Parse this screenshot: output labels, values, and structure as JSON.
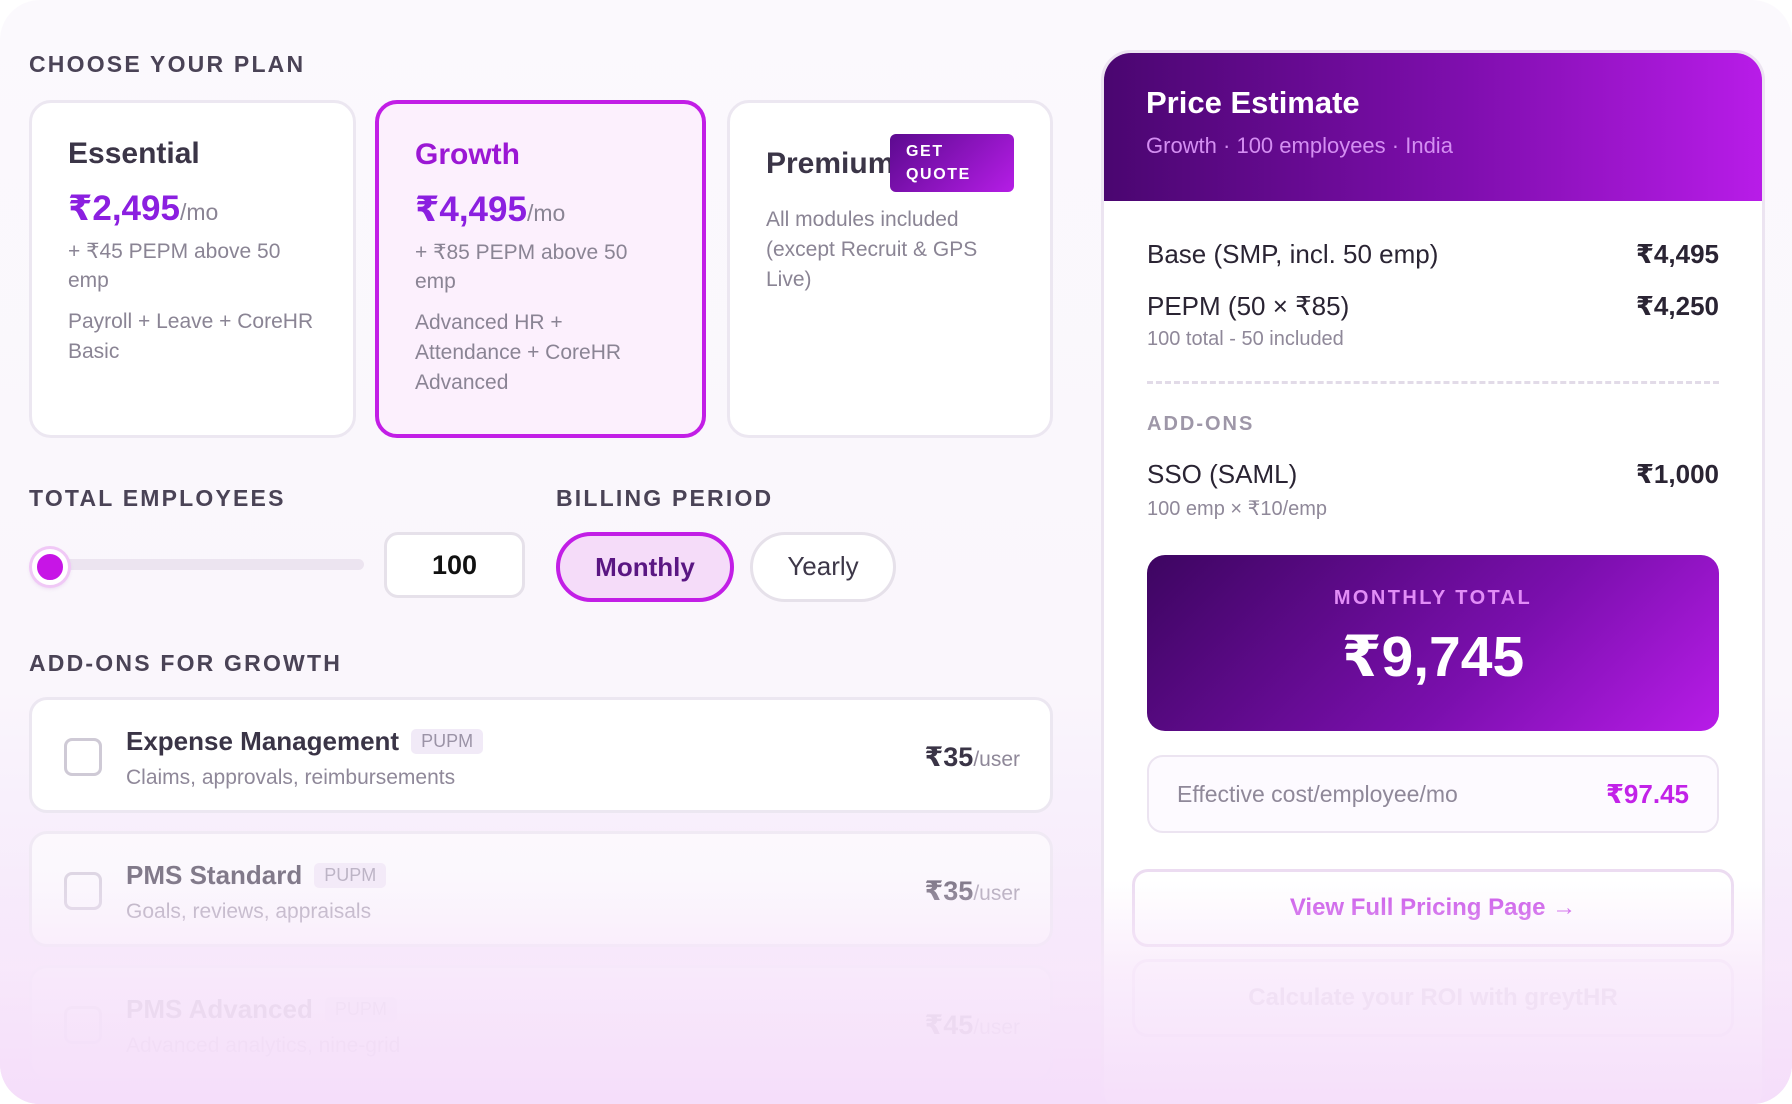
{
  "plans_section": {
    "label": "CHOOSE YOUR PLAN"
  },
  "plans": [
    {
      "name": "Essential",
      "price": "₹2,495",
      "period": "/mo",
      "pepm": "+ ₹45 PEPM above 50 emp",
      "modules": "Payroll + Leave + CoreHR Basic",
      "selected": false
    },
    {
      "name": "Growth",
      "price": "₹4,495",
      "period": "/mo",
      "pepm": "+ ₹85 PEPM above 50 emp",
      "modules": "Advanced HR + Attendance + CoreHR Advanced",
      "selected": true
    },
    {
      "name": "Premium",
      "badge": "GET QUOTE",
      "description": "All modules included (except Recruit & GPS Live)",
      "selected": false
    }
  ],
  "employees": {
    "label": "TOTAL EMPLOYEES",
    "value": "100",
    "slider_fraction": 0.02
  },
  "billing": {
    "label": "BILLING PERIOD",
    "options": [
      "Monthly",
      "Yearly"
    ],
    "selected": "Monthly"
  },
  "addons_section": {
    "label": "ADD-ONS FOR GROWTH"
  },
  "addons": [
    {
      "title": "Expense Management",
      "tag": "PUPM",
      "subtitle": "Claims, approvals, reimbursements",
      "price": "₹35",
      "unit": "/user",
      "checked": false
    },
    {
      "title": "PMS Standard",
      "tag": "PUPM",
      "subtitle": "Goals, reviews, appraisals",
      "price": "₹35",
      "unit": "/user",
      "checked": false
    },
    {
      "title": "PMS Advanced",
      "tag": "PUPM",
      "subtitle": "Advanced analytics, nine-grid",
      "price": "₹45",
      "unit": "/user",
      "checked": false
    }
  ],
  "estimate": {
    "title": "Price Estimate",
    "subtitle": "Growth · 100 employees · India",
    "base_label": "Base (SMP, incl. 50 emp)",
    "base_value": "₹4,495",
    "pepm_label": "PEPM (50 × ₹85)",
    "pepm_value": "₹4,250",
    "pepm_note": "100 total - 50 included",
    "addons_label": "ADD-ONS",
    "addon_label": "SSO (SAML)",
    "addon_value": "₹1,000",
    "addon_note": "100 emp × ₹10/emp",
    "total_label": "MONTHLY TOTAL",
    "total_value": "₹9,745",
    "effective_label": "Effective cost/employee/mo",
    "effective_value": "₹97.45",
    "pricing_link": "View Full Pricing Page →",
    "roi_link": "Calculate your ROI with greytHR"
  },
  "colors": {
    "accent": "#c21ee6",
    "brand_dark": "#4a0670",
    "brand_light": "#b81ce8"
  }
}
